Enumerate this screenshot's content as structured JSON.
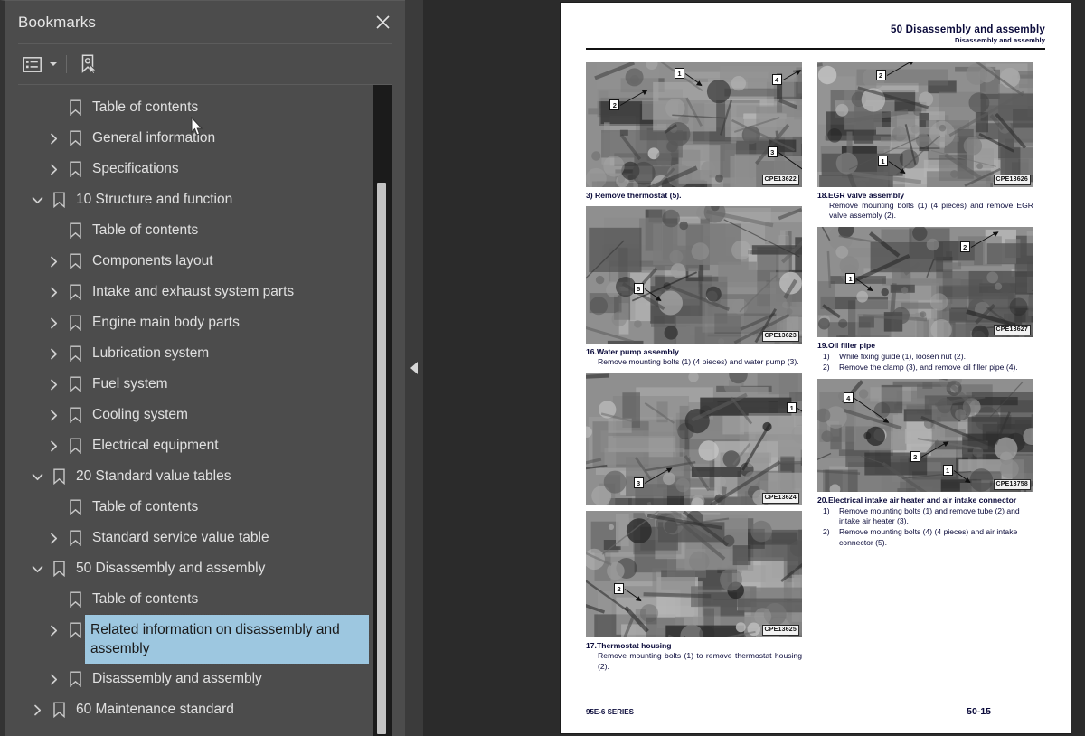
{
  "panel": {
    "title": "Bookmarks",
    "close_icon": "close-icon",
    "toolbar": {
      "options_icon": "list-options-icon",
      "caret_icon": "chevron-down-icon",
      "new_bookmark_icon": "new-bookmark-icon"
    },
    "collapse_icon": "collapse-left-triangle-icon"
  },
  "tree": [
    {
      "label": "Table of contents",
      "level": 1,
      "twisty": "none",
      "selected": false
    },
    {
      "label": "General information",
      "level": 1,
      "twisty": "collapsed",
      "selected": false
    },
    {
      "label": "Specifications",
      "level": 1,
      "twisty": "collapsed",
      "selected": false
    },
    {
      "label": "10 Structure and function",
      "level": 0,
      "twisty": "expanded",
      "selected": false
    },
    {
      "label": "Table of contents",
      "level": 1,
      "twisty": "none",
      "selected": false
    },
    {
      "label": "Components layout",
      "level": 1,
      "twisty": "collapsed",
      "selected": false
    },
    {
      "label": "Intake and exhaust system parts",
      "level": 1,
      "twisty": "collapsed",
      "selected": false
    },
    {
      "label": "Engine main body parts",
      "level": 1,
      "twisty": "collapsed",
      "selected": false
    },
    {
      "label": "Lubrication system",
      "level": 1,
      "twisty": "collapsed",
      "selected": false
    },
    {
      "label": "Fuel system",
      "level": 1,
      "twisty": "collapsed",
      "selected": false
    },
    {
      "label": "Cooling system",
      "level": 1,
      "twisty": "collapsed",
      "selected": false
    },
    {
      "label": "Electrical equipment",
      "level": 1,
      "twisty": "collapsed",
      "selected": false
    },
    {
      "label": "20 Standard value tables",
      "level": 0,
      "twisty": "expanded",
      "selected": false
    },
    {
      "label": "Table of contents",
      "level": 1,
      "twisty": "none",
      "selected": false
    },
    {
      "label": "Standard service value table",
      "level": 1,
      "twisty": "collapsed",
      "selected": false
    },
    {
      "label": "50 Disassembly and assembly",
      "level": 0,
      "twisty": "expanded",
      "selected": false
    },
    {
      "label": "Table of contents",
      "level": 1,
      "twisty": "none",
      "selected": false
    },
    {
      "label": "Related information on disassembly and assembly",
      "level": 1,
      "twisty": "collapsed",
      "selected": true
    },
    {
      "label": "Disassembly and assembly",
      "level": 1,
      "twisty": "collapsed",
      "selected": false
    },
    {
      "label": "60 Maintenance standard",
      "level": 0,
      "twisty": "collapsed",
      "selected": false
    }
  ],
  "document": {
    "header_title": "50 Disassembly and assembly",
    "header_subtitle": "Disassembly and assembly",
    "footer_series": "95E-6 SERIES",
    "footer_page": "50-15",
    "left_column": [
      {
        "code": "CPE13622",
        "callouts": [
          "1",
          "2",
          "3",
          "4"
        ],
        "caption_title": "3) Remove thermostat (5).",
        "caption_body": "",
        "steps": []
      },
      {
        "code": "CPE13623",
        "callouts": [
          "5"
        ],
        "caption_title": "16.Water pump assembly",
        "caption_body": "Remove mounting bolts (1) (4 pieces) and water pump (3).",
        "steps": []
      },
      {
        "code": "CPE13624",
        "callouts": [
          "1",
          "3"
        ],
        "caption_title": "",
        "caption_body": "",
        "steps": []
      },
      {
        "code": "CPE13625",
        "callouts": [
          "2"
        ],
        "caption_title": "17.Thermostat housing",
        "caption_body": "Remove mounting bolts (1) to remove thermostat housing (2).",
        "steps": []
      }
    ],
    "right_column": [
      {
        "code": "CPE13626",
        "callouts": [
          "1",
          "2"
        ],
        "caption_title": "18.EGR valve assembly",
        "caption_body": "Remove mounting bolts (1) (4 pieces) and remove EGR valve assembly (2).",
        "steps": []
      },
      {
        "code": "CPE13627",
        "callouts": [
          "1",
          "2"
        ],
        "caption_title": "19.Oil filler pipe",
        "caption_body": "",
        "steps": [
          {
            "num": "1)",
            "text": "While fixing guide (1), loosen nut (2)."
          },
          {
            "num": "2)",
            "text": "Remove the clamp (3), and remove oil filler pipe (4)."
          }
        ]
      },
      {
        "code": "CPE13758",
        "callouts": [
          "1",
          "2",
          "4"
        ],
        "caption_title": "20.Electrical intake air heater and air intake connector",
        "caption_body": "",
        "steps": [
          {
            "num": "1)",
            "text": "Remove mounting bolts (1) and remove tube (2) and intake air heater (3)."
          },
          {
            "num": "2)",
            "text": "Remove mounting bolts (4) (4 pieces) and air intake connector (5)."
          }
        ]
      }
    ]
  },
  "colors": {
    "panel_bg": "#4c4c4c",
    "viewer_bg": "#2b2b2b",
    "selection": "#9dc7e0",
    "doc_text": "#0b0b3b",
    "page_bg": "#ffffff"
  }
}
